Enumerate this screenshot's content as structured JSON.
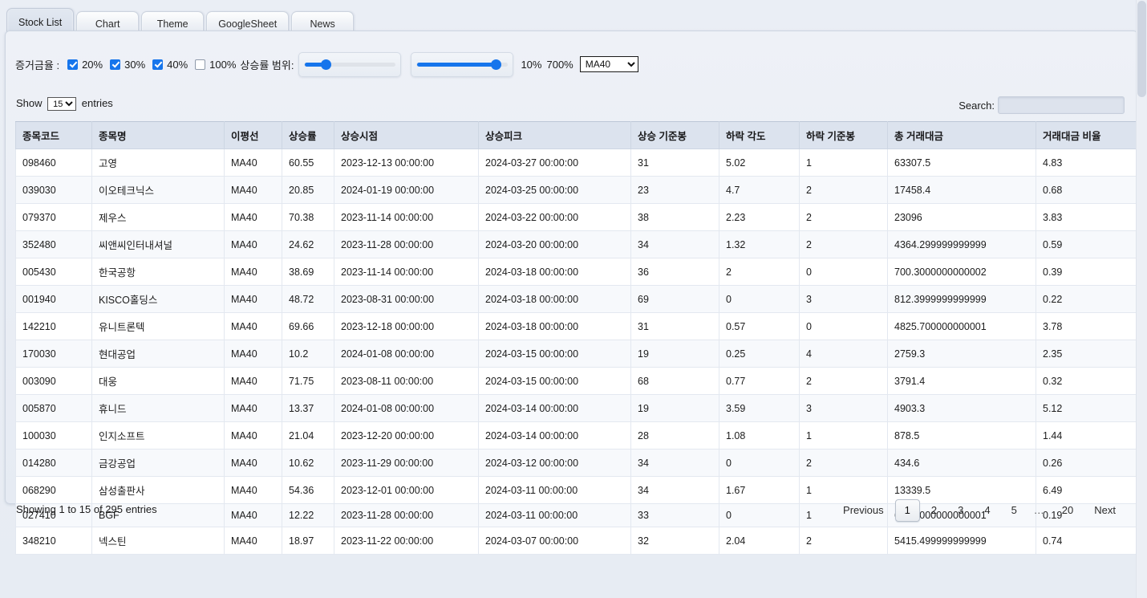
{
  "tabs": [
    {
      "label": "Stock List",
      "active": true
    },
    {
      "label": "Chart",
      "active": false
    },
    {
      "label": "Theme",
      "active": false
    },
    {
      "label": "GoogleSheet",
      "active": false
    },
    {
      "label": "News",
      "active": false
    }
  ],
  "controls": {
    "margin_label": "증거금율 :",
    "checkboxes": [
      {
        "label": "20%",
        "checked": true
      },
      {
        "label": "30%",
        "checked": true
      },
      {
        "label": "40%",
        "checked": true
      },
      {
        "label": "100%",
        "checked": false
      }
    ],
    "range_label": "상승률 범위:",
    "slider_min": {
      "value": 10,
      "percent": 20
    },
    "slider_max": {
      "value": 700,
      "percent": 92
    },
    "min_pct_text": "10%",
    "max_pct_text": "700%",
    "ma_select_value": "MA40",
    "ma_options": [
      "MA40"
    ]
  },
  "length_menu": {
    "prefix": "Show",
    "value": "15",
    "options": [
      "15"
    ],
    "suffix": "entries"
  },
  "search": {
    "label": "Search:",
    "value": "",
    "placeholder": ""
  },
  "table": {
    "columns": [
      "종목코드",
      "종목명",
      "이평선",
      "상승률",
      "상승시점",
      "상승피크",
      "상승 기준봉",
      "하락 각도",
      "하락 기준봉",
      "총 거래대금",
      "거래대금 비율"
    ],
    "rows": [
      [
        "098460",
        "고영",
        "MA40",
        "60.55",
        "2023-12-13 00:00:00",
        "2024-03-27 00:00:00",
        "31",
        "5.02",
        "1",
        "63307.5",
        "4.83"
      ],
      [
        "039030",
        "이오테크닉스",
        "MA40",
        "20.85",
        "2024-01-19 00:00:00",
        "2024-03-25 00:00:00",
        "23",
        "4.7",
        "2",
        "17458.4",
        "0.68"
      ],
      [
        "079370",
        "제우스",
        "MA40",
        "70.38",
        "2023-11-14 00:00:00",
        "2024-03-22 00:00:00",
        "38",
        "2.23",
        "2",
        "23096",
        "3.83"
      ],
      [
        "352480",
        "씨앤씨인터내셔널",
        "MA40",
        "24.62",
        "2023-11-28 00:00:00",
        "2024-03-20 00:00:00",
        "34",
        "1.32",
        "2",
        "4364.299999999999",
        "0.59"
      ],
      [
        "005430",
        "한국공항",
        "MA40",
        "38.69",
        "2023-11-14 00:00:00",
        "2024-03-18 00:00:00",
        "36",
        "2",
        "0",
        "700.3000000000002",
        "0.39"
      ],
      [
        "001940",
        "KISCO홀딩스",
        "MA40",
        "48.72",
        "2023-08-31 00:00:00",
        "2024-03-18 00:00:00",
        "69",
        "0",
        "3",
        "812.3999999999999",
        "0.22"
      ],
      [
        "142210",
        "유니트론텍",
        "MA40",
        "69.66",
        "2023-12-18 00:00:00",
        "2024-03-18 00:00:00",
        "31",
        "0.57",
        "0",
        "4825.700000000001",
        "3.78"
      ],
      [
        "170030",
        "현대공업",
        "MA40",
        "10.2",
        "2024-01-08 00:00:00",
        "2024-03-15 00:00:00",
        "19",
        "0.25",
        "4",
        "2759.3",
        "2.35"
      ],
      [
        "003090",
        "대웅",
        "MA40",
        "71.75",
        "2023-08-11 00:00:00",
        "2024-03-15 00:00:00",
        "68",
        "0.77",
        "2",
        "3791.4",
        "0.32"
      ],
      [
        "005870",
        "휴니드",
        "MA40",
        "13.37",
        "2024-01-08 00:00:00",
        "2024-03-14 00:00:00",
        "19",
        "3.59",
        "3",
        "4903.3",
        "5.12"
      ],
      [
        "100030",
        "인지소프트",
        "MA40",
        "21.04",
        "2023-12-20 00:00:00",
        "2024-03-14 00:00:00",
        "28",
        "1.08",
        "1",
        "878.5",
        "1.44"
      ],
      [
        "014280",
        "금강공업",
        "MA40",
        "10.62",
        "2023-11-29 00:00:00",
        "2024-03-12 00:00:00",
        "34",
        "0",
        "2",
        "434.6",
        "0.26"
      ],
      [
        "068290",
        "삼성출판사",
        "MA40",
        "54.36",
        "2023-12-01 00:00:00",
        "2024-03-11 00:00:00",
        "34",
        "1.67",
        "1",
        "13339.5",
        "6.49"
      ],
      [
        "027410",
        "BGF",
        "MA40",
        "12.22",
        "2023-11-28 00:00:00",
        "2024-03-11 00:00:00",
        "33",
        "0",
        "1",
        "695.9000000000001",
        "0.19"
      ],
      [
        "348210",
        "넥스틴",
        "MA40",
        "18.97",
        "2023-11-22 00:00:00",
        "2024-03-07 00:00:00",
        "32",
        "2.04",
        "2",
        "5415.499999999999",
        "0.74"
      ]
    ]
  },
  "footer": {
    "info": "Showing 1 to 15 of 295 entries",
    "previous": "Previous",
    "next": "Next",
    "pages": [
      "1",
      "2",
      "3",
      "4",
      "5",
      "…",
      "20"
    ],
    "current_page": "1"
  },
  "colors": {
    "accent": "#1675ec",
    "header_bg": "#dce3ee",
    "panel_bg": "#e9edf4"
  }
}
